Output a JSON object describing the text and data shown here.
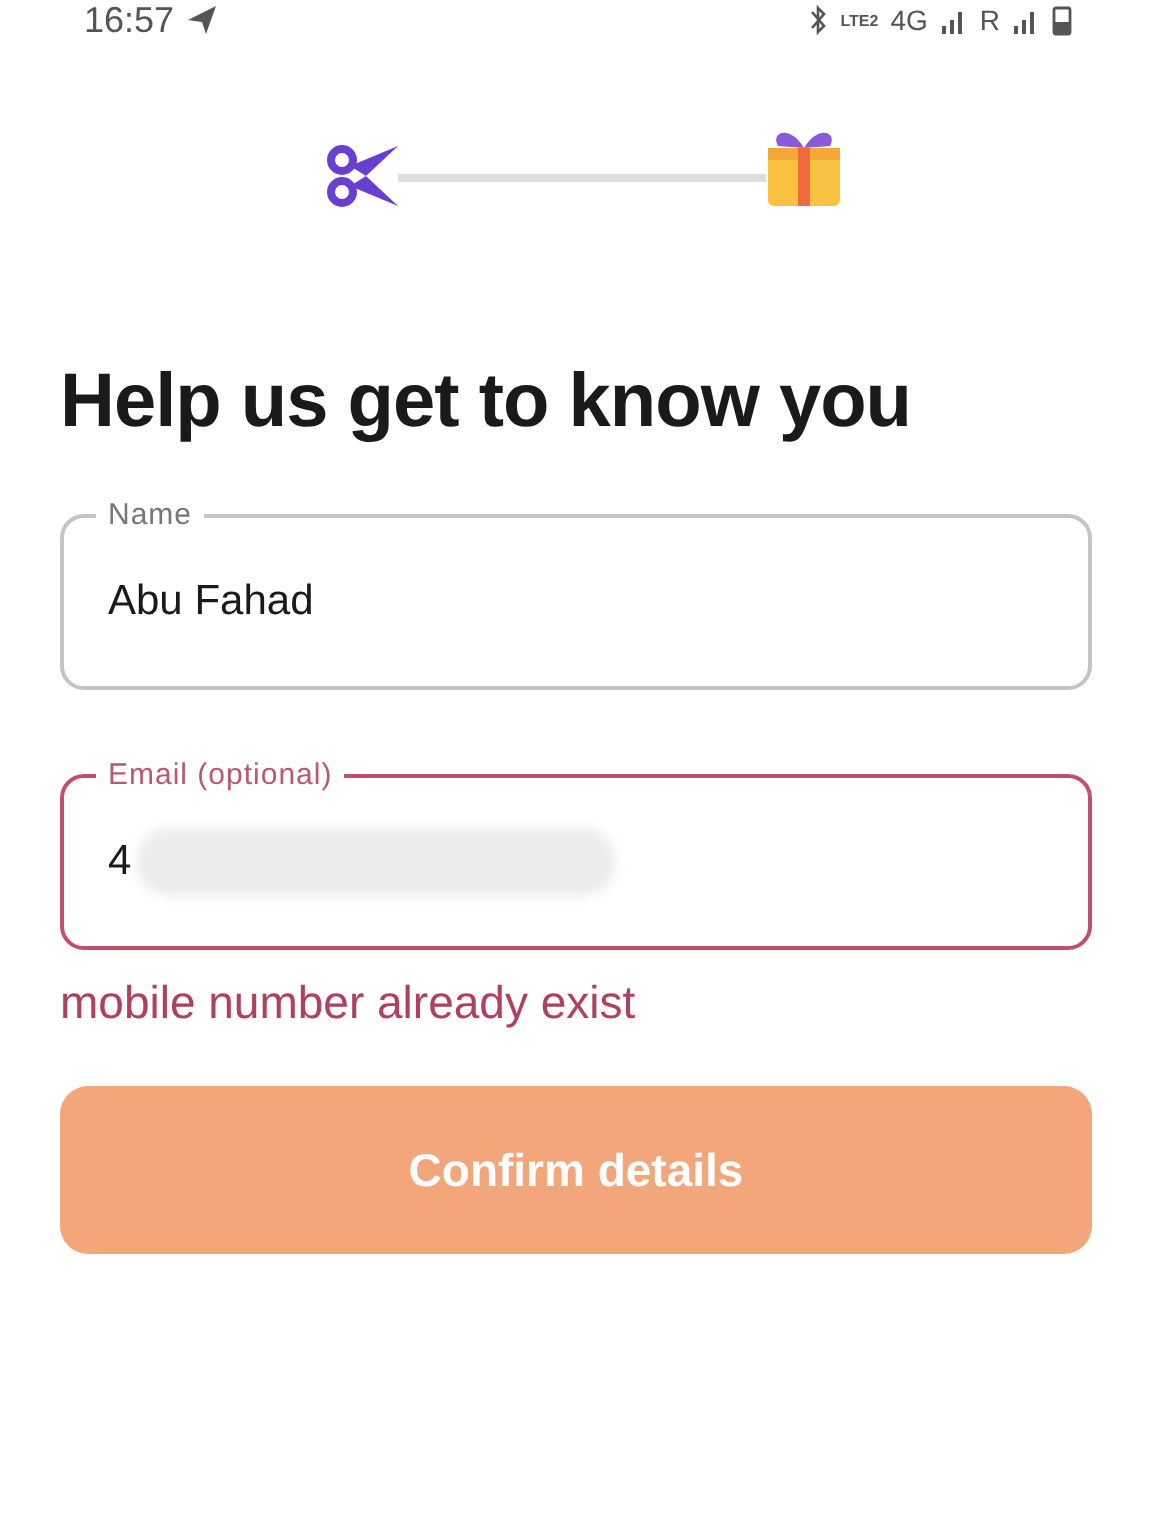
{
  "status_bar": {
    "time": "16:57",
    "network_label": "LTE2",
    "network": "4G",
    "roaming": "R"
  },
  "heading": "Help us get to know you",
  "fields": [
    {
      "label": "Name",
      "value": "Abu Fahad",
      "error": false,
      "redacted": false
    },
    {
      "label": "Email (optional)",
      "value": "4",
      "error": true,
      "redacted": true
    }
  ],
  "error_message": "mobile number already exist",
  "button": {
    "label": "Confirm details",
    "disabled": true
  }
}
